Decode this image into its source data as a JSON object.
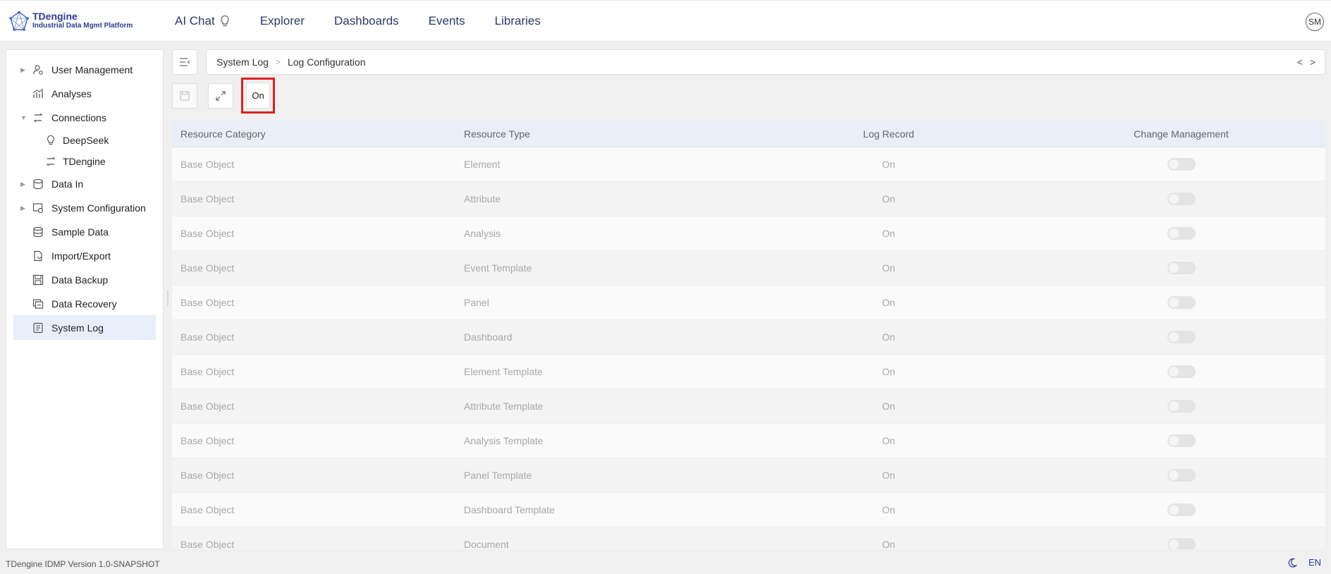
{
  "brand": {
    "title": "TDengine",
    "subtitle": "Industrial Data Mgmt Platform",
    "color": "#2a3d8f"
  },
  "topnav": [
    {
      "label": "AI Chat",
      "icon": "bulb-icon"
    },
    {
      "label": "Explorer"
    },
    {
      "label": "Dashboards"
    },
    {
      "label": "Events"
    },
    {
      "label": "Libraries"
    }
  ],
  "user": {
    "initials": "SM"
  },
  "sidebar": {
    "items": [
      {
        "label": "User Management",
        "icon": "user-icon",
        "expandable": true
      },
      {
        "label": "Analyses",
        "icon": "analyses-icon"
      },
      {
        "label": "Connections",
        "icon": "connections-icon",
        "expanded": true
      },
      {
        "label": "DeepSeek",
        "icon": "bulb-icon",
        "sub": true
      },
      {
        "label": "TDengine",
        "icon": "connections-icon",
        "sub": true
      },
      {
        "label": "Data In",
        "icon": "data-in-icon",
        "expandable": true
      },
      {
        "label": "System Configuration",
        "icon": "system-config-icon",
        "expandable": true
      },
      {
        "label": "Sample Data",
        "icon": "database-icon"
      },
      {
        "label": "Import/Export",
        "icon": "import-export-icon"
      },
      {
        "label": "Data Backup",
        "icon": "backup-icon"
      },
      {
        "label": "Data Recovery",
        "icon": "recovery-icon"
      },
      {
        "label": "System Log",
        "icon": "log-icon",
        "active": true
      }
    ]
  },
  "breadcrumb": {
    "root": "System Log",
    "current": "Log Configuration"
  },
  "toolbar": {
    "on_label": "On"
  },
  "table": {
    "headers": [
      "Resource Category",
      "Resource Type",
      "Log Record",
      "Change Management"
    ],
    "rows": [
      {
        "category": "Base Object",
        "type": "Element",
        "record": "On",
        "change": false
      },
      {
        "category": "Base Object",
        "type": "Attribute",
        "record": "On",
        "change": false
      },
      {
        "category": "Base Object",
        "type": "Analysis",
        "record": "On",
        "change": false
      },
      {
        "category": "Base Object",
        "type": "Event Template",
        "record": "On",
        "change": false
      },
      {
        "category": "Base Object",
        "type": "Panel",
        "record": "On",
        "change": false
      },
      {
        "category": "Base Object",
        "type": "Dashboard",
        "record": "On",
        "change": false
      },
      {
        "category": "Base Object",
        "type": "Element Template",
        "record": "On",
        "change": false
      },
      {
        "category": "Base Object",
        "type": "Attribute Template",
        "record": "On",
        "change": false
      },
      {
        "category": "Base Object",
        "type": "Analysis Template",
        "record": "On",
        "change": false
      },
      {
        "category": "Base Object",
        "type": "Panel Template",
        "record": "On",
        "change": false
      },
      {
        "category": "Base Object",
        "type": "Dashboard Template",
        "record": "On",
        "change": false
      },
      {
        "category": "Base Object",
        "type": "Document",
        "record": "On",
        "change": false
      }
    ]
  },
  "footer": {
    "version": "TDengine IDMP Version 1.0-SNAPSHOT",
    "language": "EN"
  }
}
